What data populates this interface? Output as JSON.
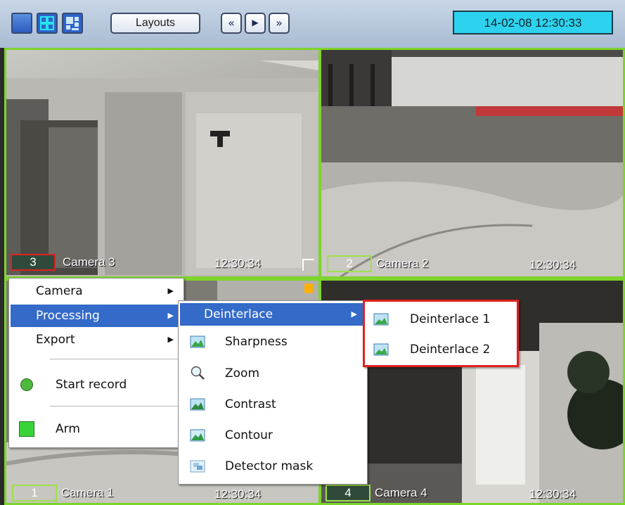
{
  "toolbar": {
    "layouts_label": "Layouts",
    "nav_prev_label": "«",
    "nav_play_label": "▶",
    "nav_next_label": "»",
    "datetime": "14-02-08   12:30:33"
  },
  "cameras": [
    {
      "number": "3",
      "name": "Camera 3",
      "time": "12:30:34"
    },
    {
      "number": "2",
      "name": "Camera 2",
      "time": "12:30:34"
    },
    {
      "number": "1",
      "name": "Camera 1",
      "time": "12:30:34"
    },
    {
      "number": "4",
      "name": "Camera 4",
      "time": "12:30:34"
    }
  ],
  "context_menu": {
    "items": [
      "Camera",
      "Processing",
      "Export",
      "Start record",
      "Arm"
    ]
  },
  "processing_menu": {
    "items": [
      "Deinterlace",
      "Sharpness",
      "Zoom",
      "Contrast",
      "Contour",
      "Detector mask"
    ]
  },
  "deinterlace_menu": {
    "items": [
      "Deinterlace 1",
      "Deinterlace 2"
    ]
  },
  "colors": {
    "accent_selection": "#346ac8",
    "tile_border": "#7dd42b",
    "highlight_box": "#e02020",
    "clock_bg": "#2cd2ee"
  }
}
